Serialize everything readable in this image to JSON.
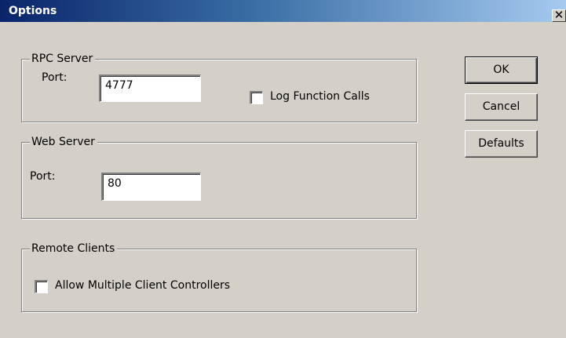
{
  "window": {
    "title": "Options",
    "close_glyph": "✕"
  },
  "rpc_server": {
    "group_label": "RPC Server",
    "port_label": "Port:",
    "port_value": "4777",
    "log_calls_label": "Log Function Calls",
    "log_calls_checked": false
  },
  "web_server": {
    "group_label": "Web Server",
    "port_label": "Port:",
    "port_value": "80"
  },
  "remote_clients": {
    "group_label": "Remote Clients",
    "allow_multiple_label": "Allow Multiple Client Controllers",
    "allow_multiple_checked": false
  },
  "buttons": {
    "ok": "OK",
    "cancel": "Cancel",
    "defaults": "Defaults"
  },
  "colors": {
    "dialog_bg": "#d4d0c8",
    "titlebar_start": "#0a246a",
    "titlebar_end": "#a6caf0",
    "title_text": "#ffffff"
  }
}
